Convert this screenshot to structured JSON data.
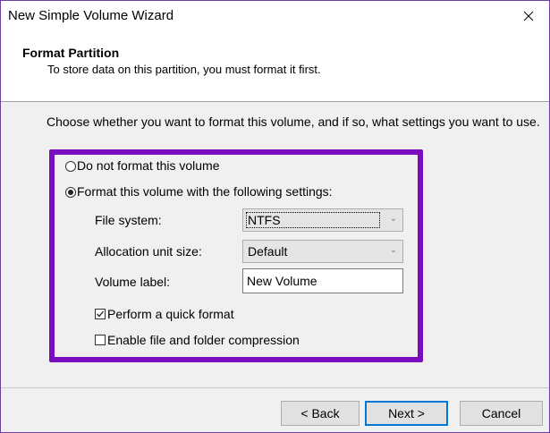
{
  "window": {
    "title": "New Simple Volume Wizard"
  },
  "header": {
    "title": "Format Partition",
    "subtitle": "To store data on this partition, you must format it first."
  },
  "instructions": "Choose whether you want to format this volume, and if so, what settings you want to use.",
  "options": {
    "no_format": {
      "label": "Do not format this volume",
      "selected": false
    },
    "format": {
      "label": "Format this volume with the following settings:",
      "selected": true
    }
  },
  "settings": {
    "file_system": {
      "label": "File system:",
      "value": "NTFS"
    },
    "allocation_unit": {
      "label": "Allocation unit size:",
      "value": "Default"
    },
    "volume_label": {
      "label": "Volume label:",
      "value": "New Volume"
    },
    "quick_format": {
      "label": "Perform a quick format",
      "checked": true
    },
    "compression": {
      "label": "Enable file and folder compression",
      "checked": false
    }
  },
  "buttons": {
    "back": "< Back",
    "next": "Next >",
    "cancel": "Cancel"
  },
  "colors": {
    "highlight": "#7a0dbd",
    "default_button_border": "#0078d7"
  }
}
